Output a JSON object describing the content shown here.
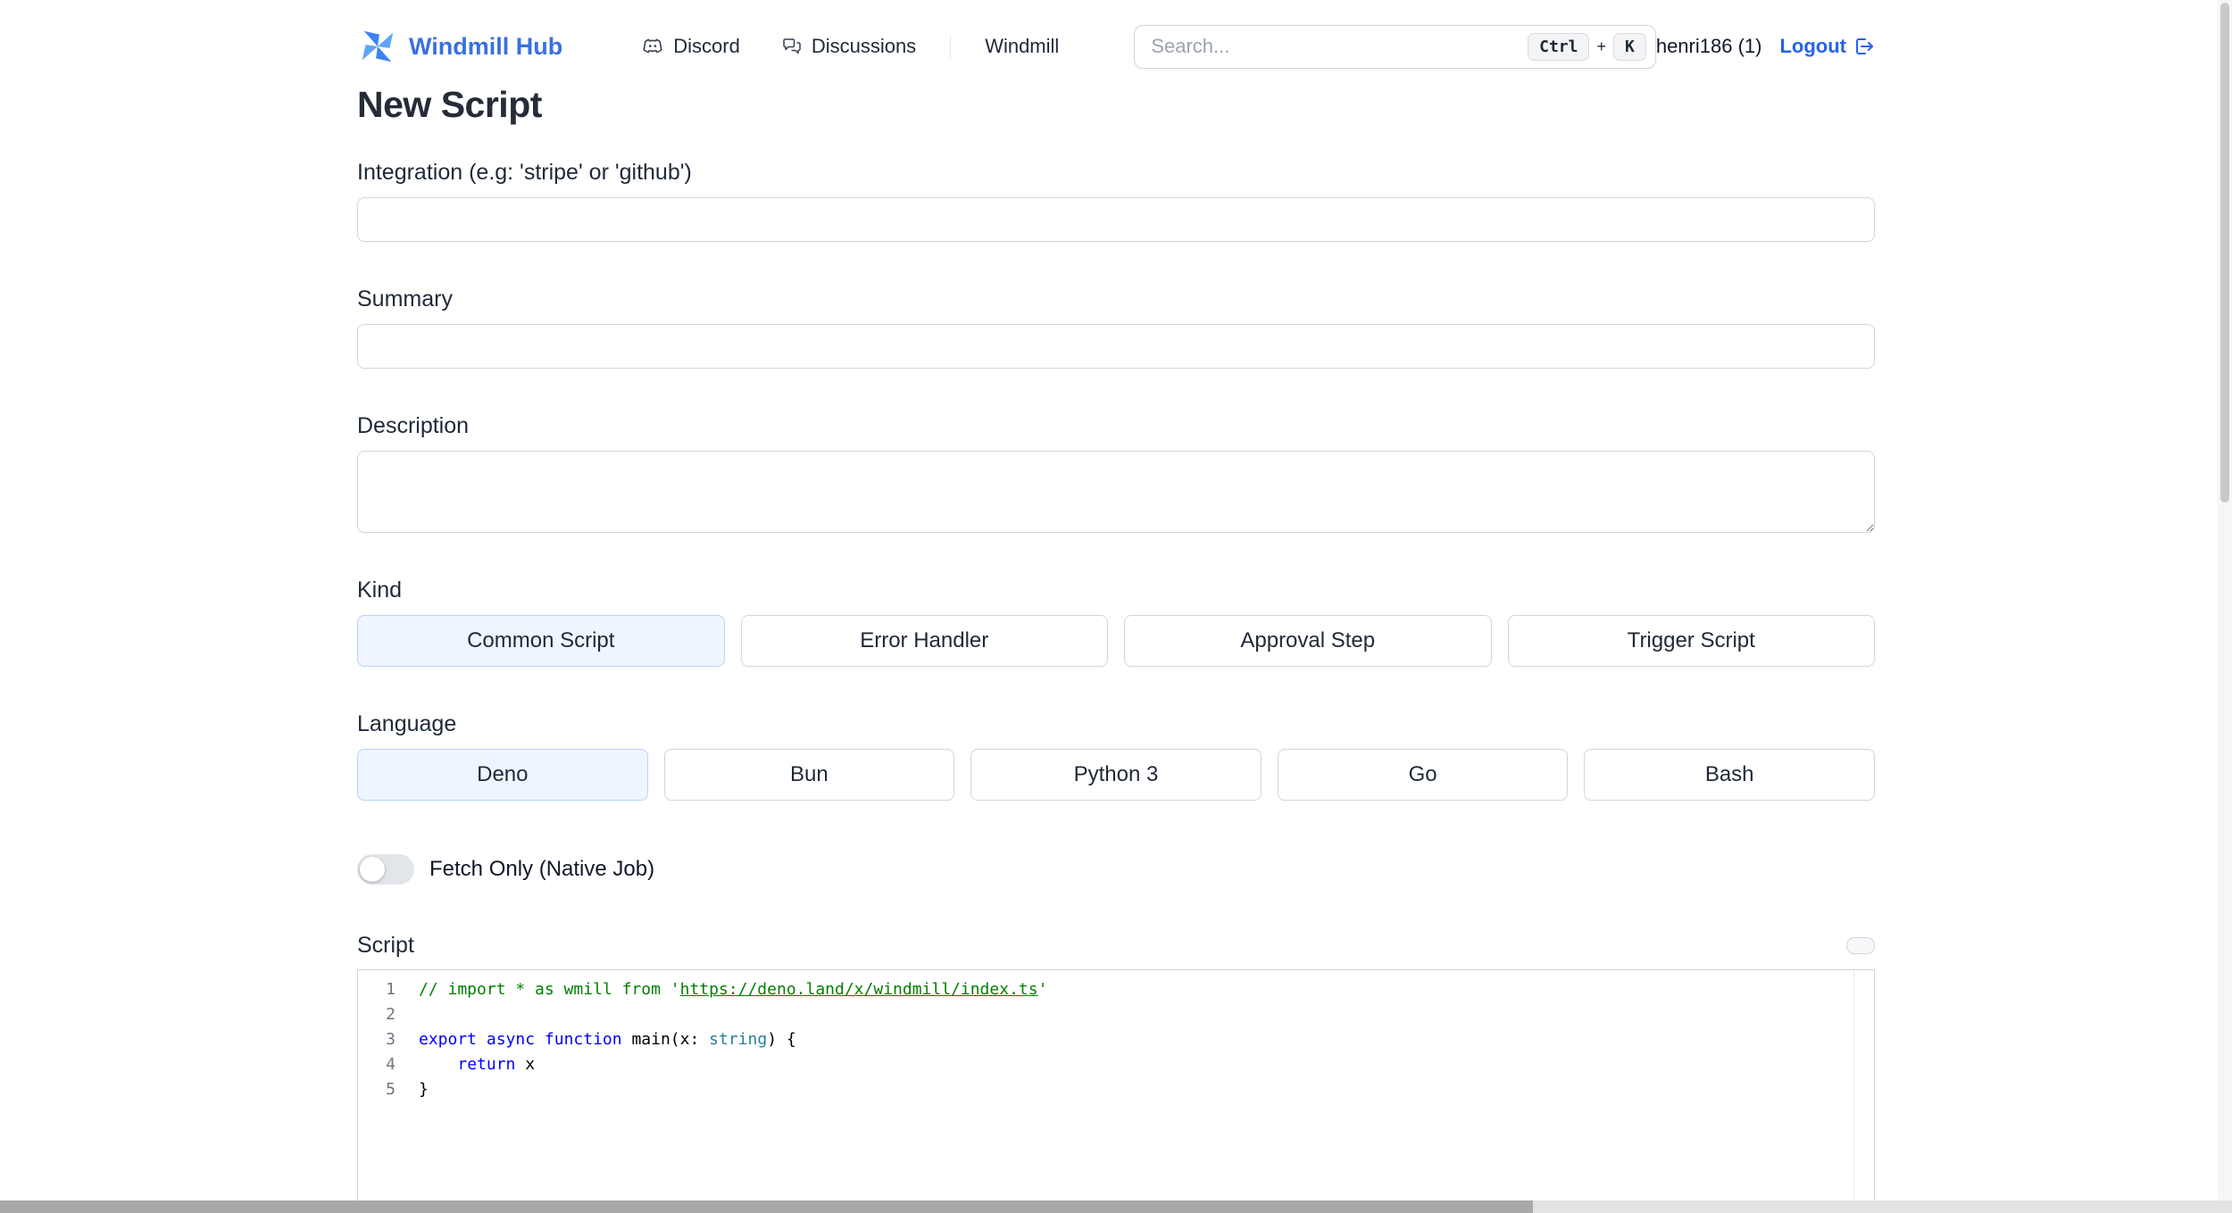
{
  "colors": {
    "brand": "#3b6fe0",
    "link": "#2563eb",
    "border": "#d1d5db",
    "muted": "#9ca3af",
    "selected_bg": "#eff6ff",
    "selected_border": "#b9d2f8",
    "code_comment": "#008000",
    "code_keyword": "#0000ff",
    "code_type": "#267f99"
  },
  "header": {
    "brand": "Windmill Hub",
    "nav": [
      {
        "label": "Discord"
      },
      {
        "label": "Discussions"
      },
      {
        "label": "Windmill"
      }
    ],
    "search": {
      "placeholder": "Search...",
      "shortcut_key_1": "Ctrl",
      "shortcut_plus": "+",
      "shortcut_key_2": "K"
    },
    "user": "henri186 (1)",
    "logout": "Logout"
  },
  "page": {
    "title": "New Script"
  },
  "form": {
    "integration": {
      "label": "Integration (e.g: 'stripe' or 'github')",
      "value": ""
    },
    "summary": {
      "label": "Summary",
      "value": ""
    },
    "description": {
      "label": "Description",
      "value": ""
    },
    "kind": {
      "label": "Kind",
      "options": [
        {
          "label": "Common Script",
          "selected": true
        },
        {
          "label": "Error Handler",
          "selected": false
        },
        {
          "label": "Approval Step",
          "selected": false
        },
        {
          "label": "Trigger Script",
          "selected": false
        }
      ]
    },
    "language": {
      "label": "Language",
      "options": [
        {
          "label": "Deno",
          "selected": true
        },
        {
          "label": "Bun",
          "selected": false
        },
        {
          "label": "Python 3",
          "selected": false
        },
        {
          "label": "Go",
          "selected": false
        },
        {
          "label": "Bash",
          "selected": false
        }
      ]
    },
    "fetch_only": {
      "label": "Fetch Only (Native Job)",
      "enabled": false
    },
    "script": {
      "label": "Script",
      "lines": [
        {
          "num": "1",
          "segs": [
            {
              "t": "c",
              "x": "// import * as wmill from '"
            },
            {
              "t": "cl",
              "x": "https://deno.land/x/windmill/index.ts"
            },
            {
              "t": "c",
              "x": "'"
            }
          ]
        },
        {
          "num": "2",
          "segs": []
        },
        {
          "num": "3",
          "segs": [
            {
              "t": "k",
              "x": "export"
            },
            {
              "t": "p",
              "x": " "
            },
            {
              "t": "k",
              "x": "async"
            },
            {
              "t": "p",
              "x": " "
            },
            {
              "t": "k",
              "x": "function"
            },
            {
              "t": "p",
              "x": " main(x: "
            },
            {
              "t": "t",
              "x": "string"
            },
            {
              "t": "p",
              "x": ") {"
            }
          ]
        },
        {
          "num": "4",
          "segs": [
            {
              "t": "p",
              "x": "    "
            },
            {
              "t": "k",
              "x": "return"
            },
            {
              "t": "p",
              "x": " x"
            }
          ]
        },
        {
          "num": "5",
          "segs": [
            {
              "t": "p",
              "x": "}"
            }
          ]
        }
      ]
    }
  }
}
